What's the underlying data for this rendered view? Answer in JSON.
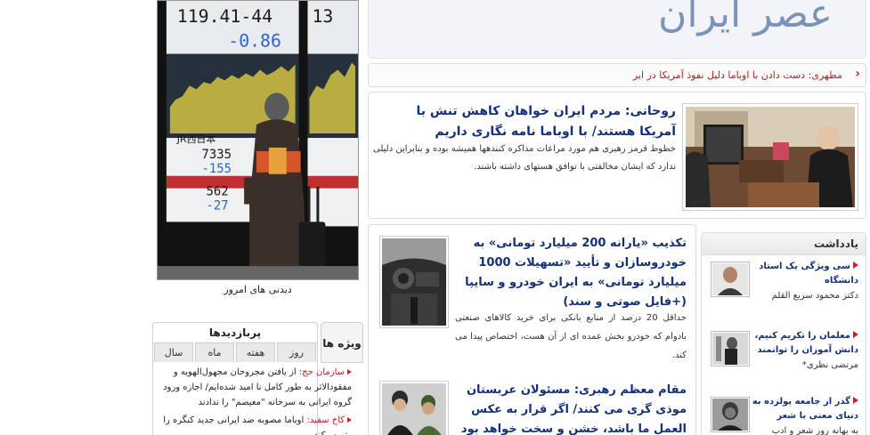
{
  "header": {
    "logo_text": "عصر ایران"
  },
  "ticker": {
    "arrow": "‹",
    "text": "مطهری: دست دادن با اوباما دلیل نفوذ آمریکا در ایر"
  },
  "lead": {
    "title": "روحانی: مردم ایران خواهان کاهش تنش با آمریکا هستند/ با اوباما نامه نگاری داریم",
    "body": "خطوط قرمز رهبری هم مورد مراعات مذاکره کنندهها همیشه بوده و بنابراین دلیلی ندارد که ایشان مخالفتی با توافق هستهای داشته باشند."
  },
  "stories": [
    {
      "title": "تکذیب «یارانه 200 میلیارد تومانی» به خودروسازان و تأیید «تسهیلات 1000 میلیارد تومانی» به ایران خودرو و سایپا (+فایل صوتی و سند)",
      "body": "حداقل 20 درصد از منابع بانکی برای خرید کالاهای صنعتی بادوام که خودرو بخش عمده ای از آن هست، اختصاص پیدا می کند."
    },
    {
      "title": "مقام معظم رهبری: مسئولان عربستان موذی گری می کنند/ اگر قرار به عکس العمل ما باشد، خشن و سخت خواهد بود",
      "body": ""
    }
  ],
  "notes": {
    "header": "یادداشت",
    "items": [
      {
        "title": "سی ویژگی یک استاد دانشگاه",
        "author": "دکتر محمود سریع القلم"
      },
      {
        "title": "معلمان را تکریم کنیم، دانش آموزان را توانمند",
        "author": "مرتضی نظری*"
      },
      {
        "title": "گذر از جامعه پولزده به دنیای معنی با شعر",
        "author": "به بهانه روز شعر و ادب"
      }
    ]
  },
  "photo_day": {
    "caption": "دیدنی های امروز",
    "board_top": "119.41-44",
    "board_change": "-0.86",
    "board_label": "JR西日本",
    "board_v1": "7335",
    "board_v2": "-155",
    "board_v3": "562",
    "board_v4": "-27"
  },
  "most_viewed": {
    "special_tab": "ویژه ها",
    "title": "پربازدیدها",
    "tabs": [
      "روز",
      "هفته",
      "ماه",
      "سال"
    ],
    "items": [
      {
        "category": "سازمان حج:",
        "text": "از یافتن مجروحان مجهول‌الهویه و مفقودالاثر به طور کامل نا امید شده‌ایم/ اجازه ورود گروه ایرانی به سرخانه \"معیصم\" را ندادند"
      },
      {
        "category": "کاخ سفید:",
        "text": "اوباما مصوبه ضد ایرانی جدید کنگره را وتو می‌کند"
      }
    ]
  },
  "colors": {
    "link_blue": "#14307a",
    "accent_red": "#c0272d",
    "logo_blue": "#7a93b8"
  }
}
